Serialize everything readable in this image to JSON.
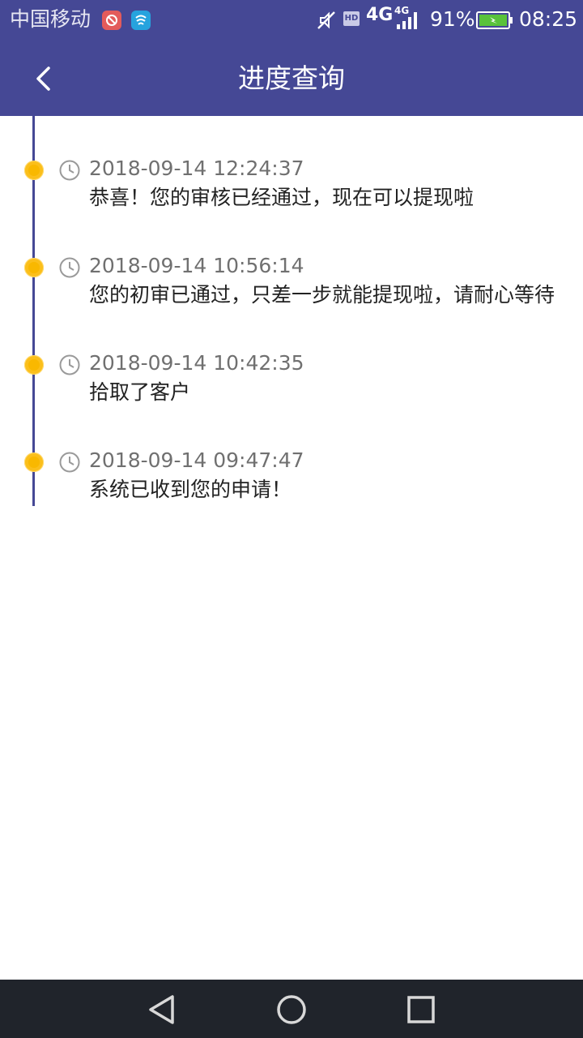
{
  "status_bar": {
    "carrier": "中国移动",
    "hd_label": "HD",
    "network_main": "4G",
    "network_secondary": "4G",
    "battery_percent": "91%",
    "time": "08:25"
  },
  "header": {
    "title": "进度查询",
    "back_icon": "chevron-left-icon"
  },
  "timeline": {
    "items": [
      {
        "time": "2018-09-14 12:24:37",
        "message": "恭喜！您的审核已经通过，现在可以提现啦"
      },
      {
        "time": "2018-09-14 10:56:14",
        "message": "您的初审已通过，只差一步就能提现啦，请耐心等待"
      },
      {
        "time": "2018-09-14 10:42:35",
        "message": "拾取了客户"
      },
      {
        "time": "2018-09-14 09:47:47",
        "message": "系统已收到您的申请！"
      }
    ]
  },
  "nav_bar": {
    "icons": [
      "back-triangle-icon",
      "home-circle-icon",
      "recents-square-icon"
    ]
  },
  "colors": {
    "primary": "#454895",
    "dot": "#f9b800",
    "time_text": "#707070",
    "message_text": "#222222",
    "nav_background": "#20242b"
  }
}
